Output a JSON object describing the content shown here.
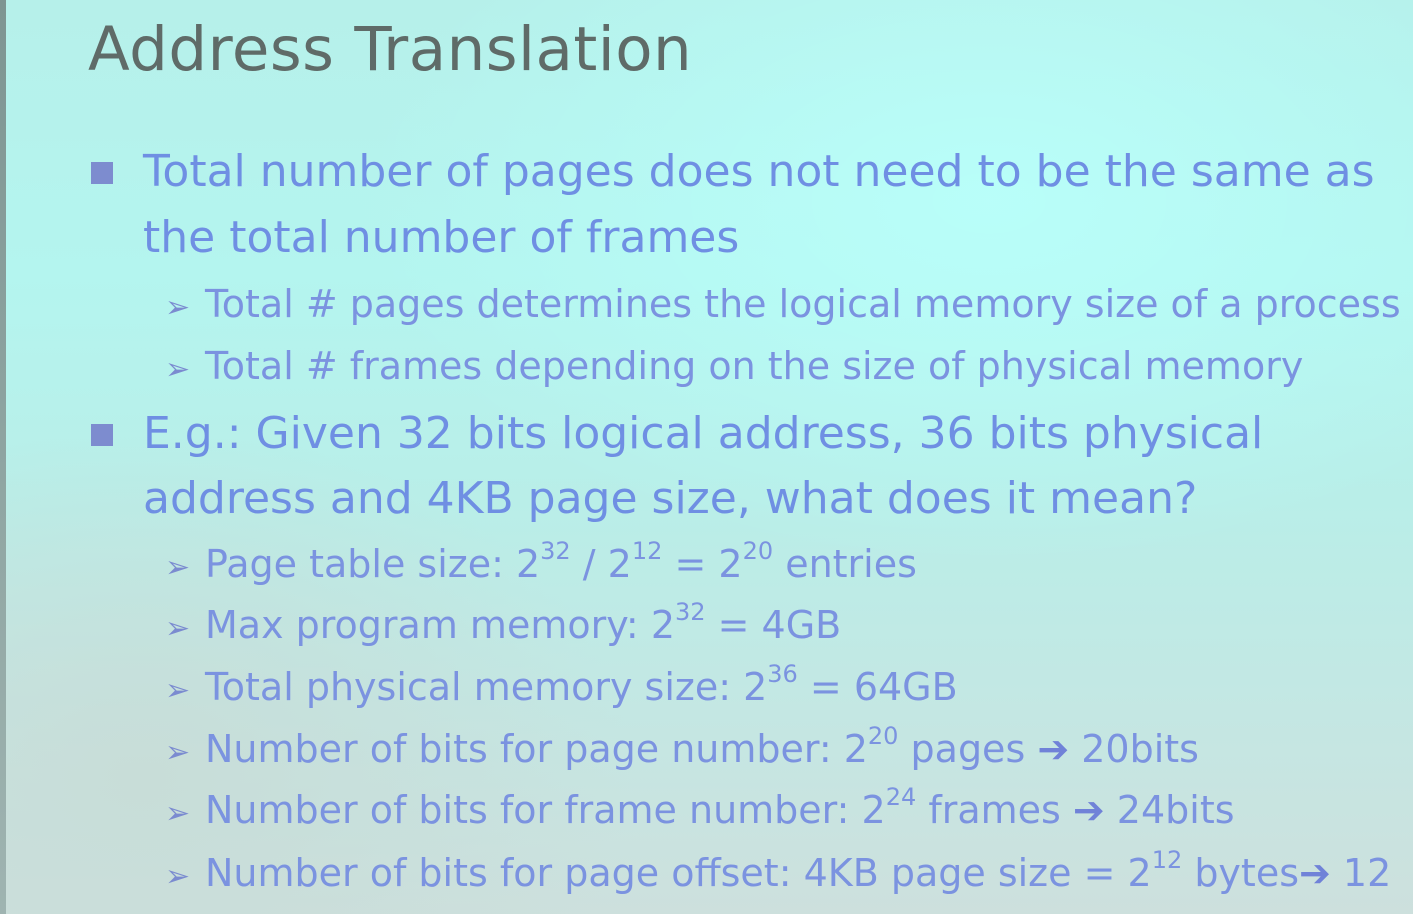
{
  "slide": {
    "title": "Address Translation",
    "bullet1": {
      "line1": "Total number of pages does not need to be the same as",
      "line2": "the total number of frames",
      "subs": [
        "Total # pages determines the logical memory size of a process",
        "Total # frames depending on the size of physical memory"
      ]
    },
    "bullet2": {
      "line1": "E.g.: Given 32 bits logical address, 36 bits physical",
      "line2": "address and 4KB page size, what does it mean?"
    },
    "items": {
      "page_table": {
        "a": "Page table size: 2",
        "e1": "32",
        "b": " / 2",
        "e2": "12",
        "c": " = 2",
        "e3": "20",
        "d": " entries"
      },
      "max_program": {
        "a": "Max program memory: 2",
        "e1": "32",
        "b": " = 4GB"
      },
      "total_physical": {
        "a": "Total physical memory size: 2",
        "e1": "36",
        "b": " = 64GB"
      },
      "page_number_bits": {
        "a": "Number of bits for page number: 2",
        "e1": "20",
        "b": " pages ",
        "arrow": "➔",
        "c": " 20bits"
      },
      "frame_number_bits": {
        "a": "Number of bits for frame number: 2",
        "e1": "24",
        "b": " frames ",
        "arrow": "➔",
        "c": " 24bits"
      },
      "page_offset_bits": {
        "a": "Number of bits for page offset: 4KB page size  = 2",
        "e1": "12",
        "b": " bytes",
        "arrow": "➔",
        "c": " 12"
      }
    },
    "sub_marker": "➢"
  }
}
